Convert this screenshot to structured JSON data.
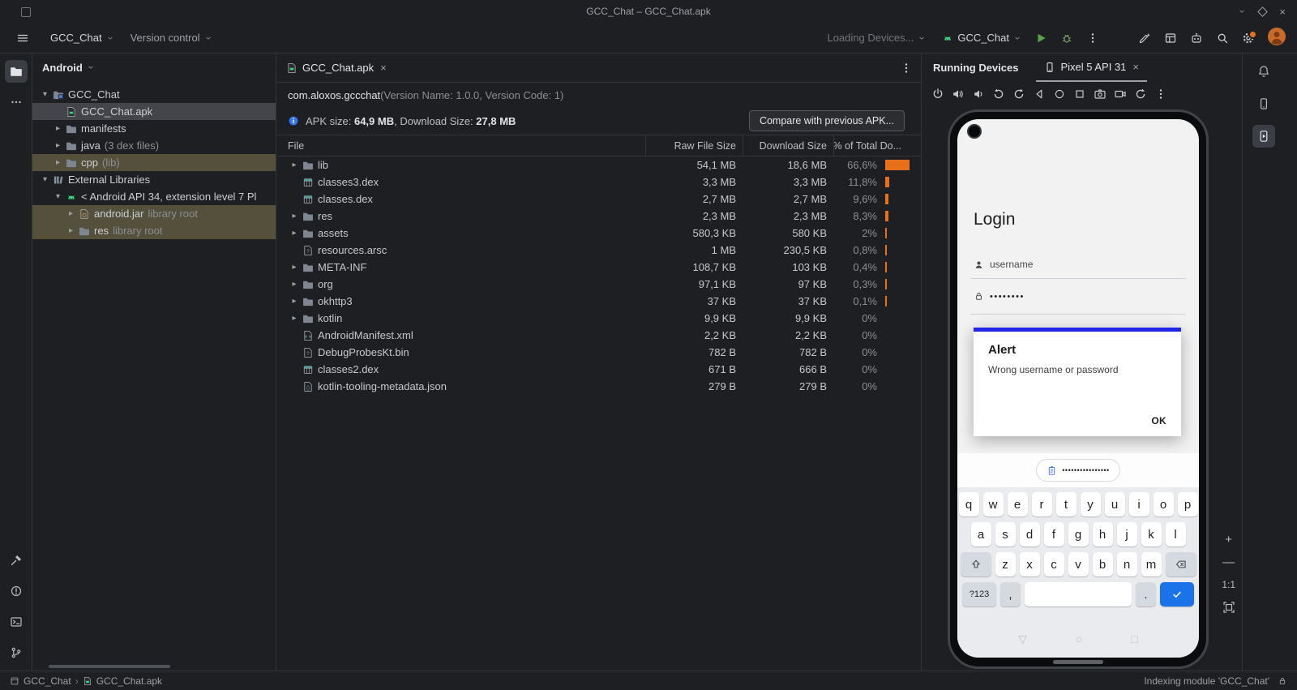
{
  "window": {
    "title": "GCC_Chat – GCC_Chat.apk"
  },
  "colors": {
    "accent_blue": "#3574f0",
    "progress_orange": "#e8701a",
    "android_green": "#3ddc84",
    "keyboard_enter_blue": "#1a73e8",
    "alert_border_blue": "#2126e8",
    "library_row_brown": "#54503c",
    "selected_row_gray": "#43454a"
  },
  "toolbar": {
    "project": "GCC_Chat",
    "version_control": "Version control",
    "devices": "Loading Devices...",
    "run_config": "GCC_Chat",
    "right_icon_names": [
      "ai-pen-icon",
      "layout-icon",
      "robot-icon",
      "search-icon",
      "settings-icon",
      "avatar"
    ]
  },
  "left_strip": {
    "top": [
      {
        "name": "project-folder-icon",
        "icon": "project-tool",
        "active": true
      },
      {
        "name": "more-tool-windows-icon",
        "icon": "more-horiz",
        "active": false
      }
    ],
    "bottom": [
      {
        "name": "build-icon",
        "icon": "build",
        "active": false
      },
      {
        "name": "problems-icon",
        "icon": "problems",
        "active": false
      },
      {
        "name": "terminal-icon",
        "icon": "terminal",
        "active": false
      },
      {
        "name": "version-control-icon",
        "icon": "version-control",
        "active": false
      }
    ]
  },
  "right_strip": {
    "items": [
      {
        "name": "notifications-icon",
        "icon": "bell",
        "active": false
      },
      {
        "name": "device-manager-icon",
        "icon": "device-manager",
        "active": false
      },
      {
        "name": "running-devices-icon",
        "icon": "running-devices",
        "active": true
      }
    ]
  },
  "project_panel": {
    "header": "Android",
    "tree": [
      {
        "label": "GCC_Chat",
        "hint": "",
        "indent": 0,
        "chevron": "down",
        "icon": "project-folder"
      },
      {
        "label": "GCC_Chat.apk",
        "hint": "",
        "indent": 1,
        "chevron": "",
        "icon": "apk",
        "selected": true
      },
      {
        "label": "manifests",
        "hint": "",
        "indent": 1,
        "chevron": "right",
        "icon": "folder"
      },
      {
        "label": "java",
        "hint": "(3 dex files)",
        "indent": 1,
        "chevron": "right",
        "icon": "folder"
      },
      {
        "label": "cpp",
        "hint": "(lib)",
        "indent": 1,
        "chevron": "right",
        "icon": "folder",
        "highlight": true
      },
      {
        "label": "External Libraries",
        "hint": "",
        "indent": 0,
        "chevron": "down",
        "icon": "libraries"
      },
      {
        "label": "< Android API 34, extension level 7 Pl",
        "hint": "",
        "indent": 1,
        "chevron": "down",
        "icon": "sdk"
      },
      {
        "label": "android.jar",
        "hint": "library root",
        "indent": 2,
        "chevron": "right",
        "icon": "jar",
        "highlight": true
      },
      {
        "label": "res",
        "hint": "library root",
        "indent": 2,
        "chevron": "right",
        "icon": "folder",
        "highlight": true
      }
    ]
  },
  "editor": {
    "tab": {
      "label": "GCC_Chat.apk"
    },
    "apk": {
      "package_name": "com.aloxos.gccchat",
      "package_meta": " (Version Name: 1.0.0, Version Code: 1)",
      "info": {
        "l1": "APK size: ",
        "v1": "64,9 MB",
        "l2": ", Download Size: ",
        "v2": "27,8 MB"
      },
      "compare_button": "Compare with previous APK...",
      "columns": [
        "File",
        "Raw File Size",
        "Download Size",
        "% of Total Do..."
      ],
      "rows": [
        {
          "name": "lib",
          "icon": "folder",
          "chevron": true,
          "raw": "54,1 MB",
          "download": "18,6 MB",
          "pct": "66,6%",
          "pct_val": 66.6
        },
        {
          "name": "classes3.dex",
          "icon": "dex",
          "chevron": false,
          "raw": "3,3 MB",
          "download": "3,3 MB",
          "pct": "11,8%",
          "pct_val": 11.8
        },
        {
          "name": "classes.dex",
          "icon": "dex",
          "chevron": false,
          "raw": "2,7 MB",
          "download": "2,7 MB",
          "pct": "9,6%",
          "pct_val": 9.6
        },
        {
          "name": "res",
          "icon": "folder",
          "chevron": true,
          "raw": "2,3 MB",
          "download": "2,3 MB",
          "pct": "8,3%",
          "pct_val": 8.3
        },
        {
          "name": "assets",
          "icon": "folder",
          "chevron": true,
          "raw": "580,3 KB",
          "download": "580 KB",
          "pct": "2%",
          "pct_val": 2
        },
        {
          "name": "resources.arsc",
          "icon": "binary",
          "chevron": false,
          "raw": "1 MB",
          "download": "230,5 KB",
          "pct": "0,8%",
          "pct_val": 0.8
        },
        {
          "name": "META-INF",
          "icon": "folder",
          "chevron": true,
          "raw": "108,7 KB",
          "download": "103 KB",
          "pct": "0,4%",
          "pct_val": 0.4
        },
        {
          "name": "org",
          "icon": "folder",
          "chevron": true,
          "raw": "97,1 KB",
          "download": "97 KB",
          "pct": "0,3%",
          "pct_val": 0.3
        },
        {
          "name": "okhttp3",
          "icon": "folder",
          "chevron": true,
          "raw": "37 KB",
          "download": "37 KB",
          "pct": "0,1%",
          "pct_val": 0.1
        },
        {
          "name": "kotlin",
          "icon": "folder",
          "chevron": true,
          "raw": "9,9 KB",
          "download": "9,9 KB",
          "pct": "0%",
          "pct_val": 0
        },
        {
          "name": "AndroidManifest.xml",
          "icon": "manifest",
          "chevron": false,
          "raw": "2,2 KB",
          "download": "2,2 KB",
          "pct": "0%",
          "pct_val": 0
        },
        {
          "name": "DebugProbesKt.bin",
          "icon": "binary",
          "chevron": false,
          "raw": "782 B",
          "download": "782 B",
          "pct": "0%",
          "pct_val": 0
        },
        {
          "name": "classes2.dex",
          "icon": "dex",
          "chevron": false,
          "raw": "671 B",
          "download": "666 B",
          "pct": "0%",
          "pct_val": 0
        },
        {
          "name": "kotlin-tooling-metadata.json",
          "icon": "json",
          "chevron": false,
          "raw": "279 B",
          "download": "279 B",
          "pct": "0%",
          "pct_val": 0
        }
      ]
    }
  },
  "devices_panel": {
    "title": "Running Devices",
    "tab": "Pixel 5 API 31",
    "zoom_label": "1:1",
    "toolbar_icons": [
      "power-icon",
      "volume-up-icon",
      "volume-down-icon",
      "rotate-left-icon",
      "rotate-right-icon",
      "back-icon",
      "home-icon",
      "overview-icon",
      "screenshot-icon",
      "screen-record-icon",
      "restart-icon",
      "more-options-icon"
    ],
    "phone": {
      "login_title": "Login",
      "username_placeholder": "username",
      "password_dots": "••••••••",
      "alert": {
        "title": "Alert",
        "message": "Wrong username or password",
        "ok": "OK"
      },
      "suggestion_dots": "••••••••••••••••",
      "keyboard": {
        "row1": [
          "q",
          "w",
          "e",
          "r",
          "t",
          "y",
          "u",
          "i",
          "o",
          "p"
        ],
        "row2": [
          "a",
          "s",
          "d",
          "f",
          "g",
          "h",
          "j",
          "k",
          "l"
        ],
        "row3": [
          "z",
          "x",
          "c",
          "v",
          "b",
          "n",
          "m"
        ],
        "symbols": "?123",
        "comma": ",",
        "period": ".",
        "space": ""
      }
    }
  },
  "status_bar": {
    "crumb_root": "GCC_Chat",
    "crumb_file": "GCC_Chat.apk",
    "right": "Indexing module 'GCC_Chat'"
  }
}
